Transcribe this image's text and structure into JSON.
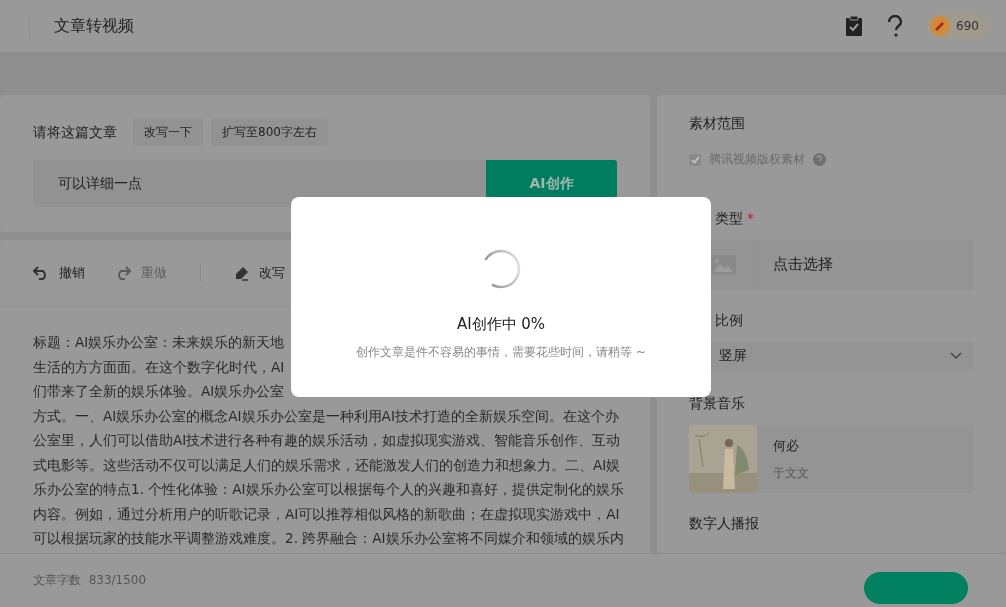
{
  "header": {
    "title": "文章转视频",
    "points": "690"
  },
  "prompt": {
    "label": "请将这篇文章",
    "chips": [
      "改写一下",
      "扩写至800字左右"
    ],
    "value": "可以详细一点",
    "submit": "AI创作"
  },
  "toolbar": [
    {
      "label": "撤销",
      "kind": "undo",
      "disabled": false
    },
    {
      "label": "重做",
      "kind": "redo",
      "disabled": true
    },
    {
      "label": "改写",
      "kind": "rewrite",
      "disabled": false
    }
  ],
  "article": {
    "lines": [
      "标题：AI娱乐办公室：未来娱乐的新天地",
      "生活的方方面面。在这个数字化时代，AI",
      "们带来了全新的娱乐体验。AI娱乐办公室",
      "方式。一、AI娱乐办公室的概念AI娱乐办公室是一种利用AI技术打造的全新娱乐空间。在这个办",
      "公室里，人们可以借助AI技术进行各种有趣的娱乐活动，如虚拟现实游戏、智能音乐创作、互动",
      "式电影等。这些活动不仅可以满足人们的娱乐需求，还能激发人们的创造力和想象力。二、AI娱",
      "乐办公室的特点1. 个性化体验：AI娱乐办公室可以根据每个人的兴趣和喜好，提供定制化的娱乐",
      "内容。例如，通过分析用户的听歌记录，AI可以推荐相似风格的新歌曲；在虚拟现实游戏中，AI",
      "可以根据玩家的技能水平调整游戏难度。2. 跨界融合：AI娱乐办公室将不同媒介和领域的娱乐内"
    ]
  },
  "footer": {
    "label": "文章字数",
    "count": "833/1500"
  },
  "settings": {
    "scope_label": "素材范围",
    "scope_option": {
      "label": "腾讯视频版权素材",
      "checked": true,
      "disabled": true
    },
    "type_label": "类型",
    "required_mark": "*",
    "type_picker": "点击选择",
    "ratio_label": "比例",
    "ratio_value": "竖屏",
    "music_label": "背景音乐",
    "music": {
      "title": "何必",
      "artist": "于文文"
    },
    "avatar_label": "数字人播报"
  },
  "modal": {
    "title": "AI创作中 0%",
    "message": "创作文章是件不容易的事情，需要花些时间，请稍等 ~"
  }
}
